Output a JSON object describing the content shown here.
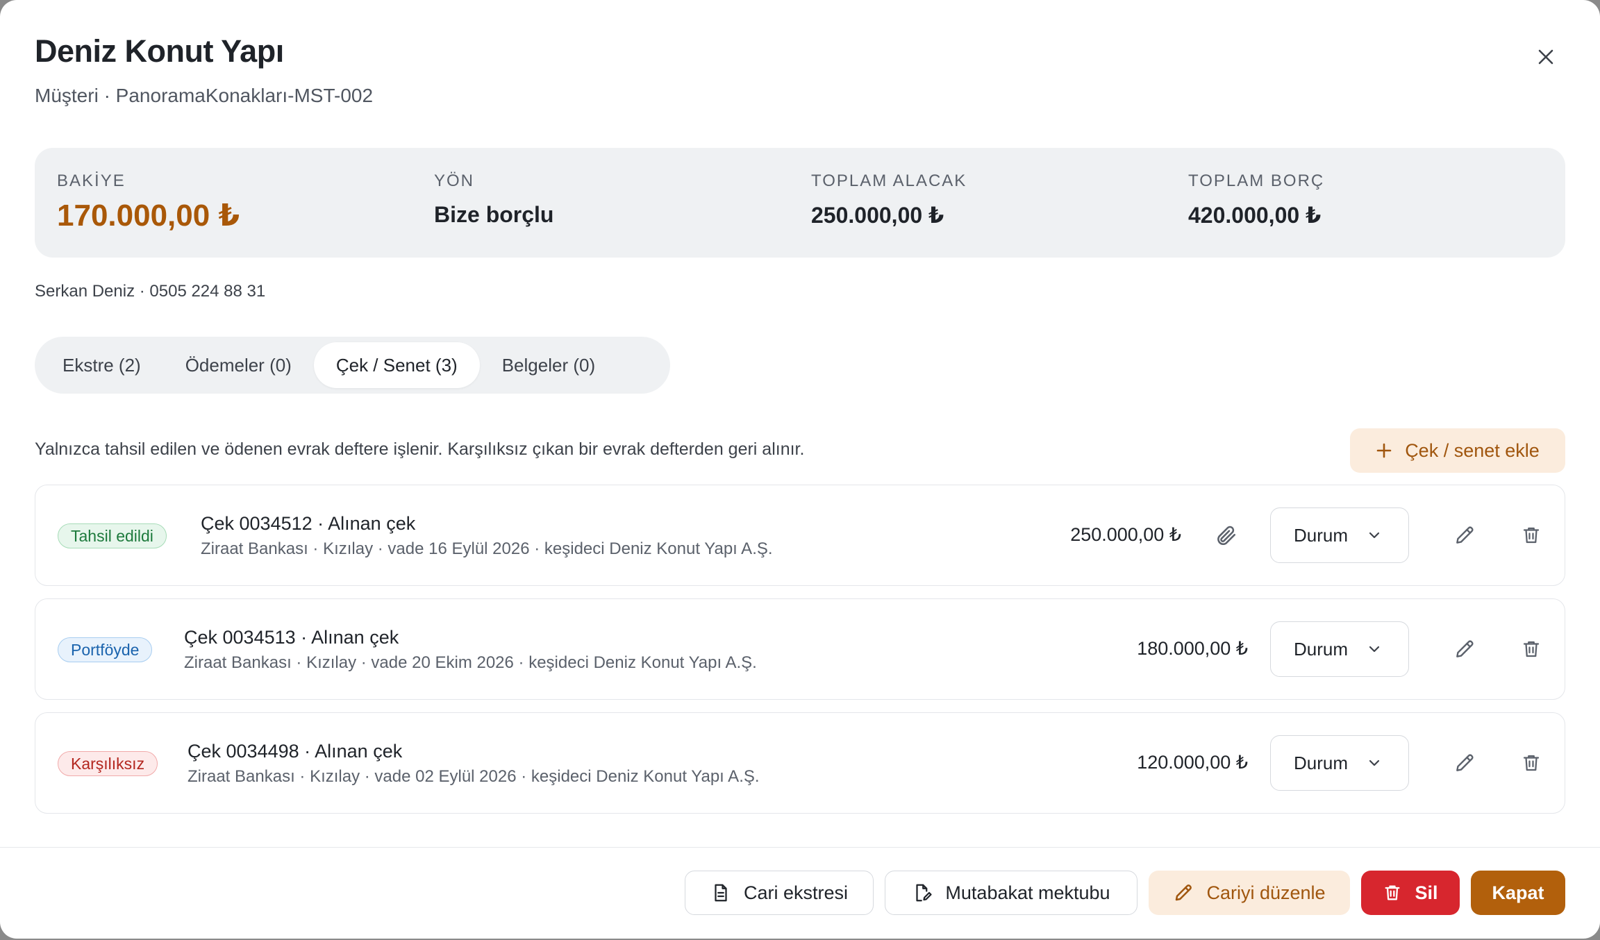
{
  "header": {
    "title": "Deniz Konut Yapı",
    "subtitle": "Müşteri · PanoramaKonakları-MST-002"
  },
  "summary": {
    "balance_label": "BAKİYE",
    "balance_value": "170.000,00 ₺",
    "direction_label": "YÖN",
    "direction_value": "Bize borçlu",
    "total_receivable_label": "TOPLAM ALACAK",
    "total_receivable_value": "250.000,00 ₺",
    "total_debt_label": "TOPLAM BORÇ",
    "total_debt_value": "420.000,00 ₺",
    "accent_color": "#a95808"
  },
  "contact": "Serkan Deniz · 0505 224 88 31",
  "tabs": [
    {
      "label": "Ekstre (2)",
      "active": false
    },
    {
      "label": "Ödemeler (0)",
      "active": false
    },
    {
      "label": "Çek / Senet (3)",
      "active": true
    },
    {
      "label": "Belgeler (0)",
      "active": false
    }
  ],
  "info_text": "Yalnızca tahsil edilen ve ödenen evrak deftere işlenir. Karşılıksız çıkan bir evrak defterden geri alınır.",
  "add_button_label": "Çek / senet ekle",
  "rows": [
    {
      "status": "Tahsil edildi",
      "status_color": "green",
      "title": "Çek 0034512 · Alınan çek",
      "detail": "Ziraat Bankası · Kızılay · vade 16 Eylül 2026 · keşideci Deniz Konut Yapı A.Ş.",
      "amount": "250.000,00 ₺",
      "has_attachment": true,
      "select_label": "Durum"
    },
    {
      "status": "Portföyde",
      "status_color": "blue",
      "title": "Çek 0034513 · Alınan çek",
      "detail": "Ziraat Bankası · Kızılay · vade 20 Ekim 2026 · keşideci Deniz Konut Yapı A.Ş.",
      "amount": "180.000,00 ₺",
      "has_attachment": false,
      "select_label": "Durum"
    },
    {
      "status": "Karşılıksız",
      "status_color": "red",
      "title": "Çek 0034498 · Alınan çek",
      "detail": "Ziraat Bankası · Kızılay · vade 02 Eylül 2026 · keşideci Deniz Konut Yapı A.Ş.",
      "amount": "120.000,00 ₺",
      "has_attachment": false,
      "select_label": "Durum"
    }
  ],
  "footer": {
    "statement_label": "Cari ekstresi",
    "reconciliation_label": "Mutabakat mektubu",
    "edit_label": "Cariyi düzenle",
    "delete_label": "Sil",
    "close_label": "Kapat"
  },
  "icons": {
    "close": "close-icon",
    "plus": "plus-icon",
    "attachment": "paperclip-icon",
    "chevron": "chevron-down-icon",
    "edit": "pencil-icon",
    "delete": "trash-icon",
    "document": "document-icon",
    "signature": "document-edit-icon"
  }
}
